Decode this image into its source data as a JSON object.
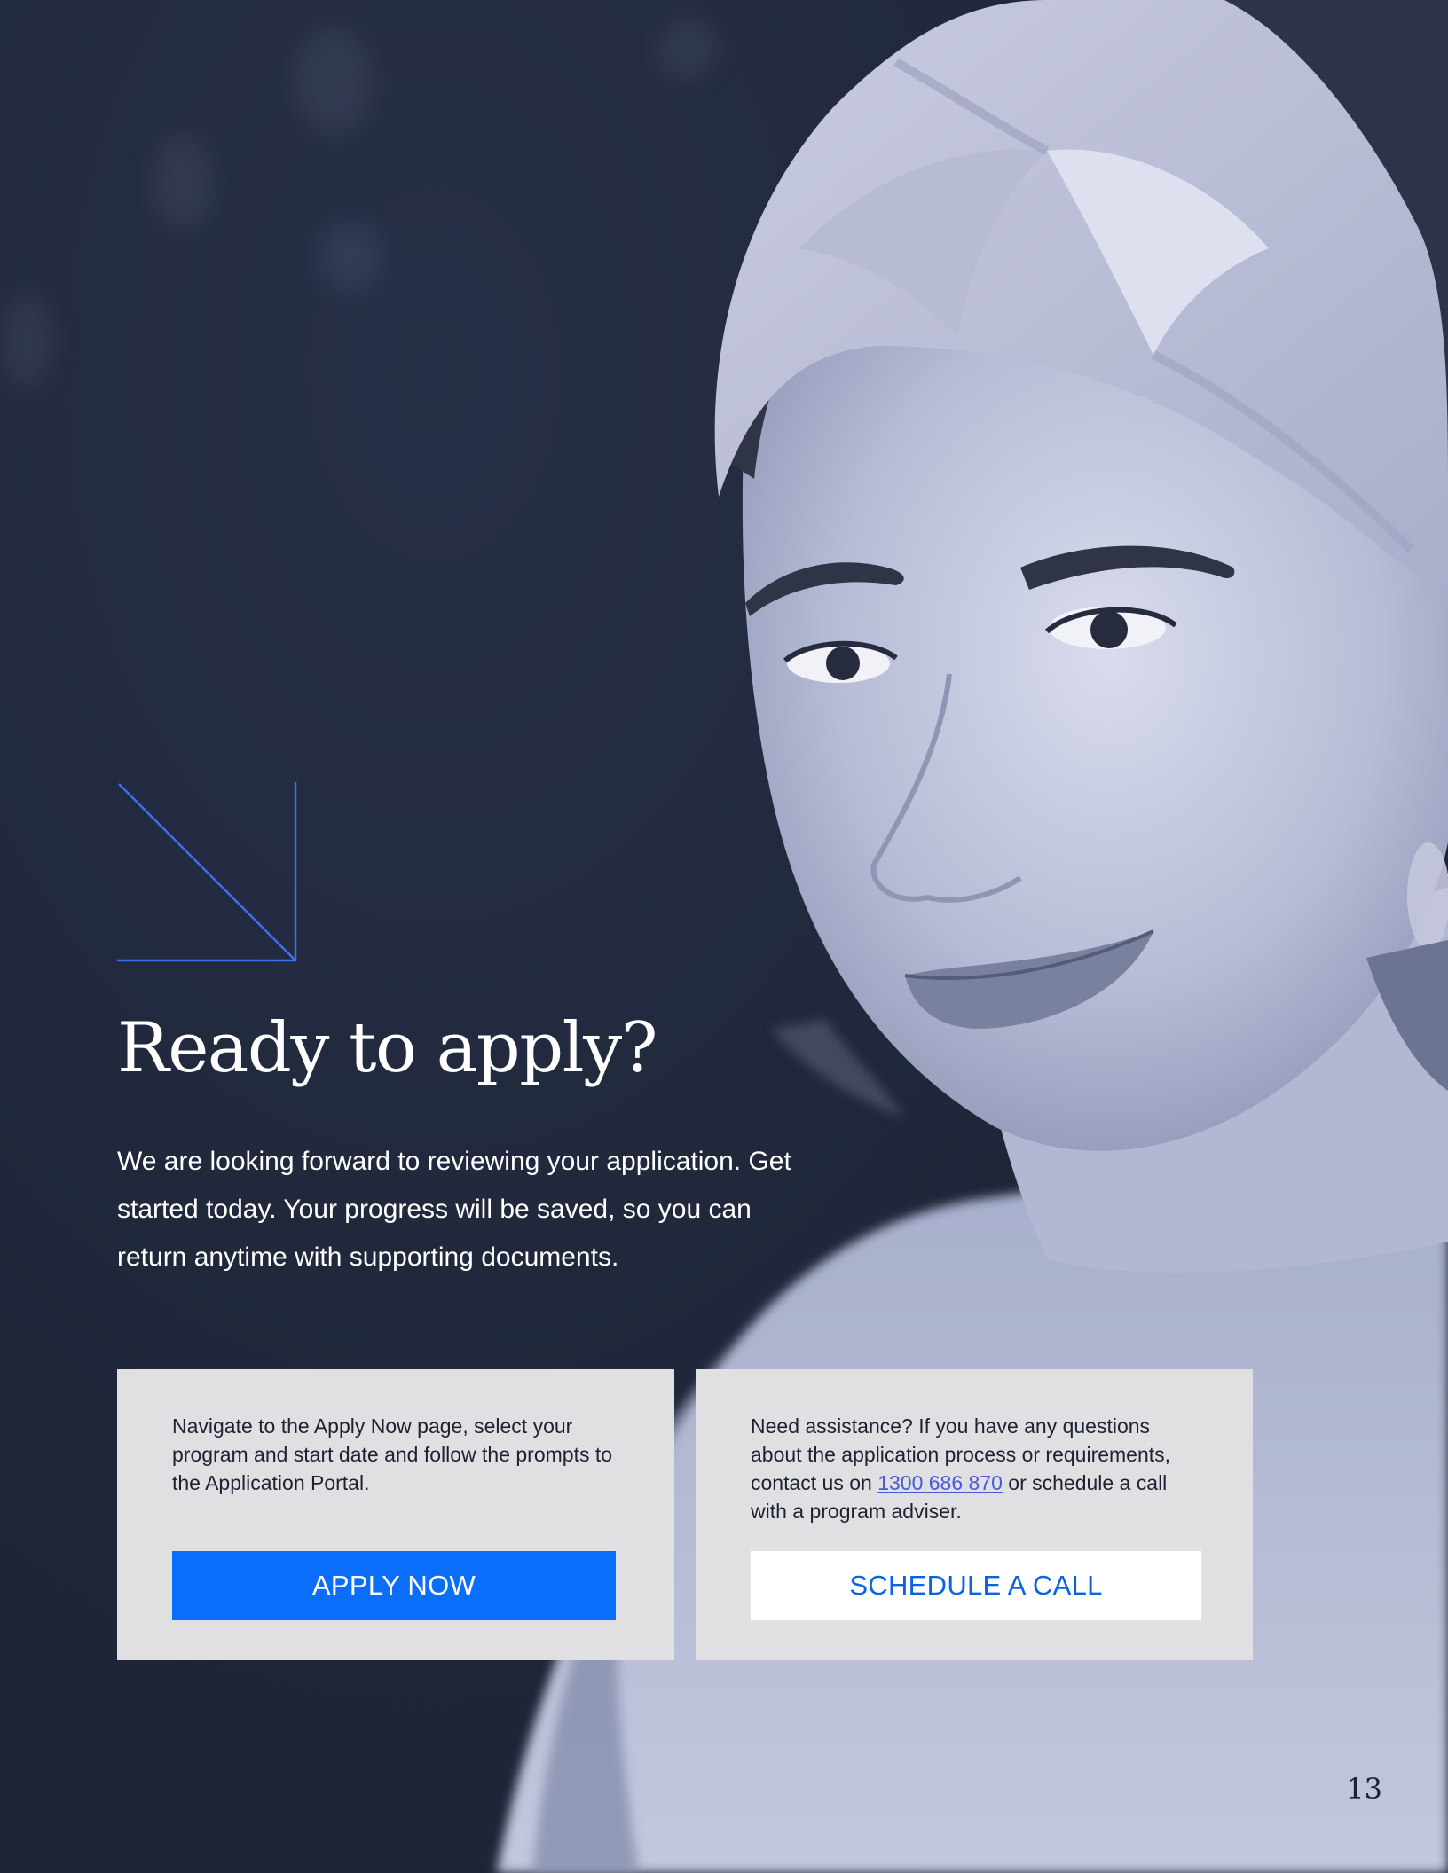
{
  "heading": "Ready to apply?",
  "intro": "We are looking forward to reviewing your application. Get started today. Your progress will be saved, so you can return anytime with supporting documents.",
  "cards": {
    "apply": {
      "text": "Navigate to the Apply Now page, select your program and start date and follow the prompts to the Application Portal.",
      "button_label": "APPLY NOW"
    },
    "assist": {
      "text_before": "Need assistance? If you have any questions about the application process or requirements, contact us on ",
      "phone": "1300 686 870",
      "text_after": " or schedule a call with a program adviser.",
      "button_label": "SCHEDULE A CALL"
    }
  },
  "page_number": "13",
  "colors": {
    "accent": "#0a6efa",
    "arrow": "#3b6ff2",
    "background": "#1f2638",
    "card": "#e0e0e3",
    "link": "#4a5ad6"
  },
  "icons": {
    "arrow": "arrow-down-right-icon"
  }
}
